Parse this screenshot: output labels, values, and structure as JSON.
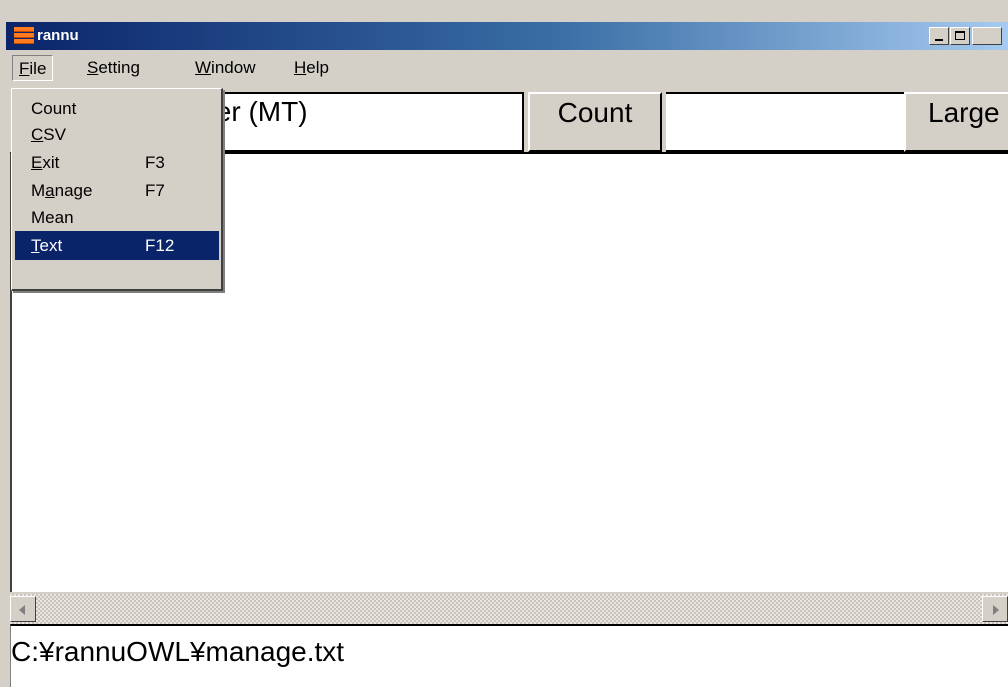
{
  "window": {
    "title": "rannu"
  },
  "menubar": {
    "items": [
      {
        "mn": "F",
        "rest": "ile"
      },
      {
        "mn": "S",
        "rest": "etting"
      },
      {
        "mn": "W",
        "rest": "indow"
      },
      {
        "mn": "H",
        "rest": "elp"
      }
    ]
  },
  "toolbar": {
    "title_field_value": "ter (MT)",
    "count_button": "Count",
    "count_value": "",
    "large_button": "Large"
  },
  "file_menu": {
    "items": [
      {
        "pre": "Count",
        "mn": "",
        "post": "",
        "shortcut": ""
      },
      {
        "pre": "",
        "mn": "C",
        "post": "SV",
        "shortcut": ""
      },
      {
        "pre": "",
        "mn": "E",
        "post": "xit",
        "shortcut": "F3"
      },
      {
        "pre": "M",
        "mn": "a",
        "post": "nage",
        "shortcut": "F7"
      },
      {
        "pre": "Mean",
        "mn": "",
        "post": "",
        "shortcut": ""
      },
      {
        "pre": "",
        "mn": "T",
        "post": "ext",
        "shortcut": "F12"
      }
    ],
    "selected_index": 5
  },
  "main": {
    "content": ""
  },
  "status": {
    "path": "C:¥rannuOWL¥manage.txt"
  },
  "colors": {
    "face": "#d4d0c8",
    "titlebar_start": "#0a246a",
    "titlebar_end": "#a6caf0",
    "selection": "#0a246a",
    "icon_orange": "#ff7a1c"
  },
  "icons": [
    "app-icon",
    "minimize-icon",
    "maximize-icon",
    "scroll-left-arrow-icon",
    "scroll-right-arrow-icon"
  ]
}
